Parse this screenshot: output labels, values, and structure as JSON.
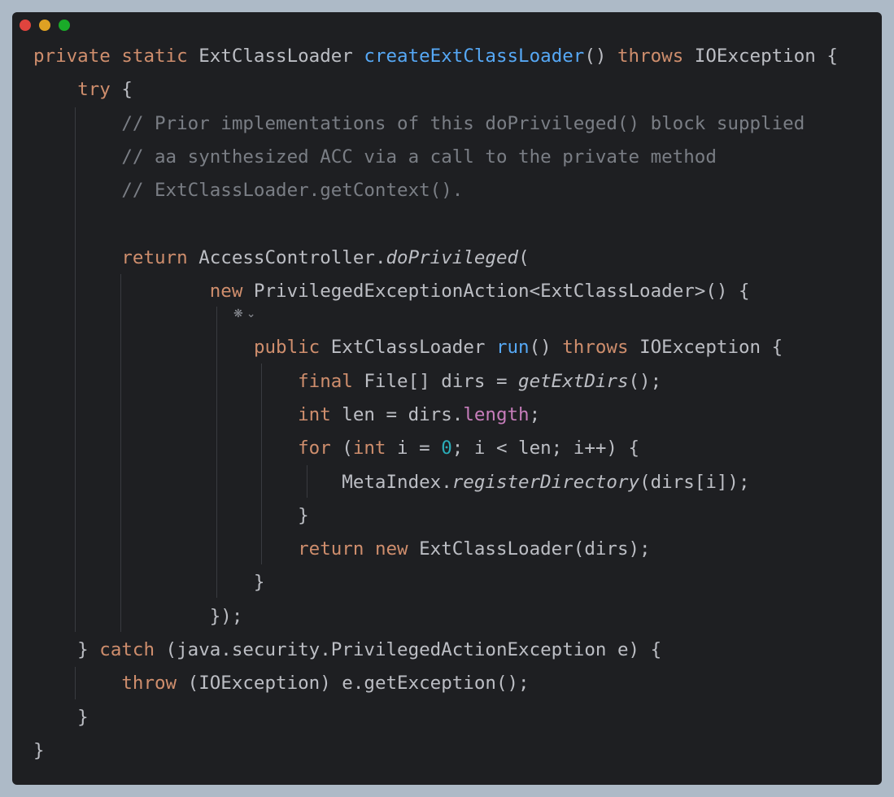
{
  "window": {
    "traffic_lights": [
      {
        "name": "close",
        "color": "#e0443e"
      },
      {
        "name": "minimize",
        "color": "#dea123"
      },
      {
        "name": "maximize",
        "color": "#1aab29"
      }
    ]
  },
  "icons": {
    "override_gutter": "override-icon",
    "fold": "chevron-down-icon"
  },
  "code": {
    "l1": {
      "a": "private",
      "b": " ",
      "c": "static",
      "d": " ExtClassLoader ",
      "e": "createExtClassLoader",
      "f": "() ",
      "g": "throws",
      "h": " IOException {"
    },
    "l2": {
      "a": "    ",
      "b": "try",
      "c": " {"
    },
    "l3": {
      "a": "        ",
      "b": "// Prior implementations of this doPrivileged() block supplied"
    },
    "l4": {
      "a": "        ",
      "b": "// aa synthesized ACC via a call to the private method"
    },
    "l5": {
      "a": "        ",
      "b": "// ExtClassLoader.getContext()."
    },
    "l7": {
      "a": "        ",
      "b": "return",
      "c": " AccessController.",
      "d": "doPrivileged",
      "e": "("
    },
    "l8": {
      "a": "                ",
      "b": "new",
      "c": " PrivilegedExceptionAction<ExtClassLoader>() {"
    },
    "l9": {
      "a": "                    ",
      "b": "public",
      "c": " ExtClassLoader ",
      "d": "run",
      "e": "() ",
      "f": "throws",
      "g": " IOException {"
    },
    "l10": {
      "a": "                        ",
      "b": "final",
      "c": " File[] dirs = ",
      "d": "getExtDirs",
      "e": "();"
    },
    "l11": {
      "a": "                        ",
      "b": "int",
      "c": " len = dirs.",
      "d": "length",
      "e": ";"
    },
    "l12": {
      "a": "                        ",
      "b": "for",
      "c": " (",
      "d": "int",
      "e": " i = ",
      "f": "0",
      "g": "; i < len; i++) {"
    },
    "l13": {
      "a": "                            MetaIndex.",
      "b": "registerDirectory",
      "c": "(dirs[i]);"
    },
    "l14": {
      "a": "                        }"
    },
    "l15": {
      "a": "                        ",
      "b": "return",
      "c": " ",
      "d": "new",
      "e": " ExtClassLoader(dirs);"
    },
    "l16": {
      "a": "                    }"
    },
    "l17": {
      "a": "                });"
    },
    "l18": {
      "a": "    } ",
      "b": "catch",
      "c": " (java.security.PrivilegedActionException e) {"
    },
    "l19": {
      "a": "        ",
      "b": "throw",
      "c": " (IOException) e.getException();"
    },
    "l20": {
      "a": "    }"
    },
    "l21": {
      "a": "}"
    }
  }
}
